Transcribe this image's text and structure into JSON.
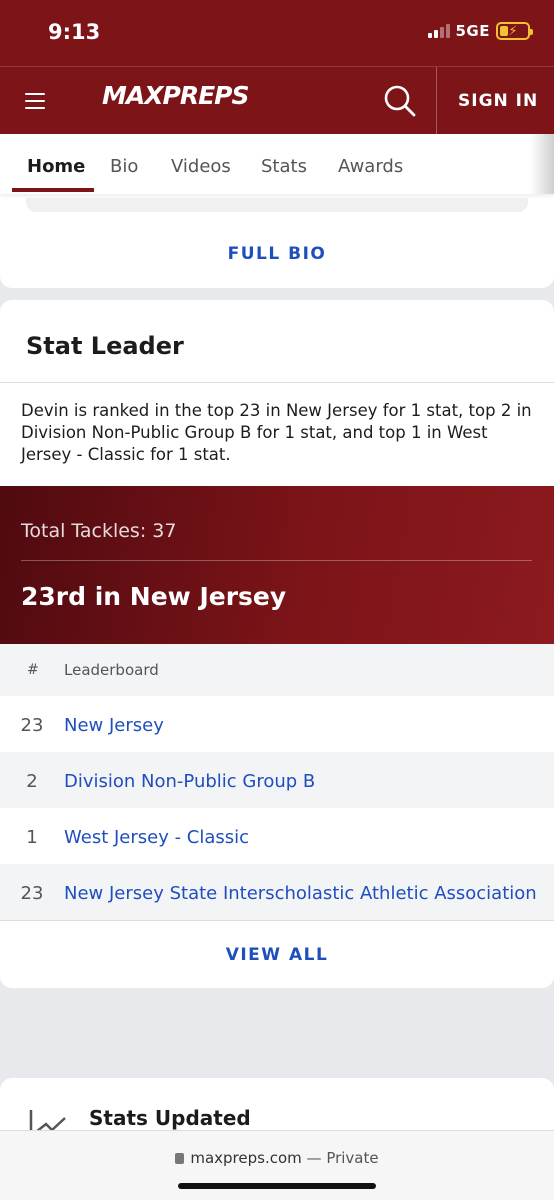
{
  "status": {
    "time": "9:13",
    "network": "5GE"
  },
  "header": {
    "logo": "MAXPREPS",
    "signin_label": "SIGN IN"
  },
  "tabs": [
    {
      "label": "Home"
    },
    {
      "label": "Bio"
    },
    {
      "label": "Videos"
    },
    {
      "label": "Stats"
    },
    {
      "label": "Awards"
    }
  ],
  "bio": {
    "full_bio_label": "FULL BIO"
  },
  "stat_leader": {
    "title": "Stat Leader",
    "description": "Devin is ranked in the top 23 in New Jersey for 1 stat, top 2 in Division Non-Public Group B for 1 stat, and top 1 in West Jersey - Classic for 1 stat.",
    "stat_label": "Total Tackles: 37",
    "rank_text": "23rd in New Jersey",
    "table": {
      "headers": [
        "#",
        "Leaderboard"
      ],
      "rows": [
        {
          "rank": "23",
          "name": "New Jersey"
        },
        {
          "rank": "2",
          "name": "Division Non-Public Group B"
        },
        {
          "rank": "1",
          "name": "West Jersey - Classic"
        },
        {
          "rank": "23",
          "name": "New Jersey State Interscholastic Athletic Association"
        }
      ]
    },
    "view_all_label": "VIEW ALL"
  },
  "updates": {
    "title": "Stats Updated"
  },
  "browser": {
    "domain": "maxpreps.com",
    "suffix": " — Private"
  },
  "colors": {
    "brand": "#7c1418",
    "link": "#1f4ebd",
    "battery": "#f1c232"
  }
}
